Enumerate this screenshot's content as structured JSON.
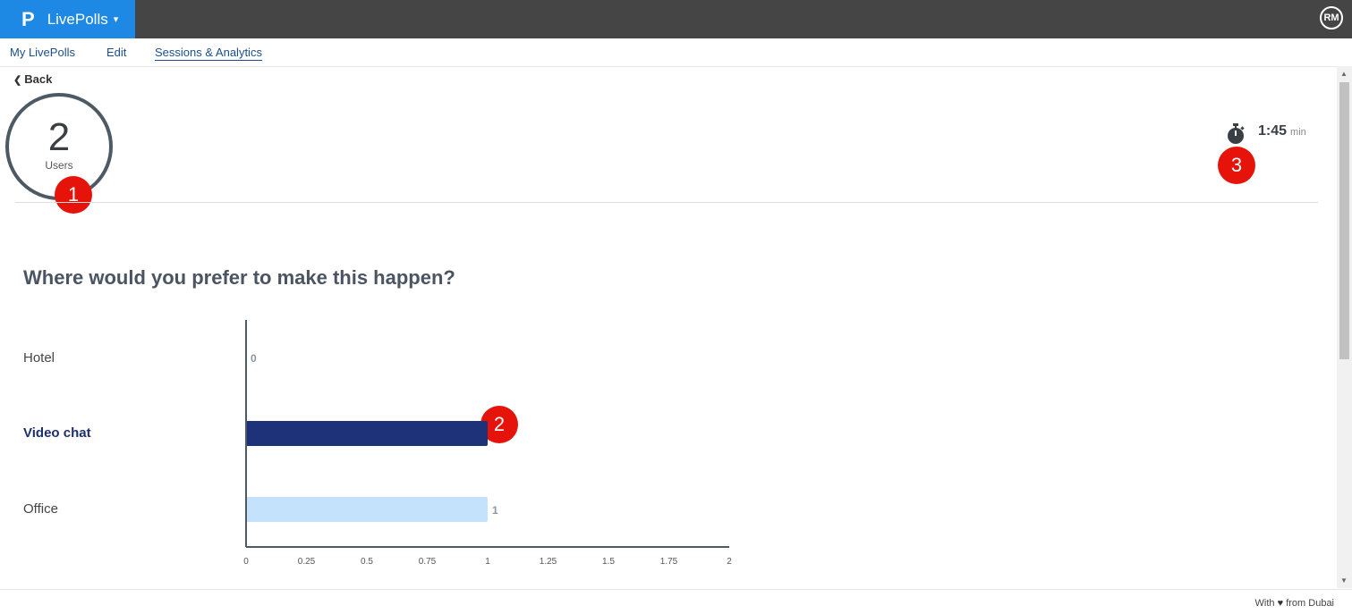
{
  "app": {
    "logo": "P",
    "name": "LivePolls",
    "caret": "▾",
    "avatar": "RM"
  },
  "nav": {
    "items": [
      "My LivePolls",
      "Edit",
      "Sessions & Analytics"
    ],
    "active": "Sessions & Analytics"
  },
  "back_label": "Back",
  "users": {
    "count": "2",
    "label": "Users"
  },
  "timer": {
    "time": "1:45",
    "unit": "min"
  },
  "badges": [
    "1",
    "2",
    "3"
  ],
  "question": "Where would you prefer to make this happen?",
  "footer": {
    "prefix": "With",
    "suffix": "from Dubai"
  },
  "colors": {
    "selected_bar": "#1e3279",
    "other_bar": "#c5e2fd",
    "brand": "#1e88e5"
  },
  "chart_data": {
    "type": "bar",
    "orientation": "horizontal",
    "categories": [
      "Hotel",
      "Video chat",
      "Office"
    ],
    "values": [
      0,
      1,
      1
    ],
    "data_labels": [
      "0",
      "",
      "1"
    ],
    "selected": "Video chat",
    "xlim": [
      0,
      2
    ],
    "xticks": [
      "0",
      "0.25",
      "0.5",
      "0.75",
      "1",
      "1.25",
      "1.5",
      "1.75",
      "2"
    ]
  }
}
